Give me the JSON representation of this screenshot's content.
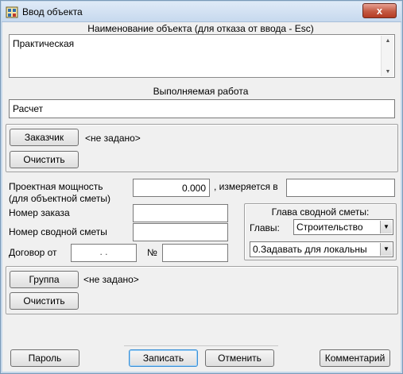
{
  "window": {
    "title": "Ввод объекта",
    "close_label": "x"
  },
  "object_name": {
    "header": "Наименование объекта (для отказа от ввода - Esc)",
    "value": "Практическая"
  },
  "work": {
    "header": "Выполняемая работа",
    "value": "Расчет"
  },
  "customer": {
    "button_label": "Заказчик",
    "value": "<не задано>",
    "clear_label": "Очистить"
  },
  "capacity": {
    "label_line1": "Проектная мощность",
    "label_line2": "(для объектной сметы)",
    "value": "0.000",
    "measured_in_label": ", измеряется в",
    "measured_in_value": ""
  },
  "order_number": {
    "label": "Номер заказа",
    "value": ""
  },
  "summary_number": {
    "label": "Номер сводной сметы",
    "value": ""
  },
  "contract": {
    "label": "Договор от",
    "date_value": " .  .",
    "number_label": "№",
    "number_value": ""
  },
  "summary_chapter": {
    "title": "Глава сводной сметы:",
    "chapters_label": "Главы:",
    "chapters_value": "Строительство",
    "mode_value": "0.Задавать для локальны"
  },
  "group": {
    "button_label": "Группа",
    "value": "<не задано>",
    "clear_label": "Очистить"
  },
  "footer": {
    "password_label": "Пароль",
    "save_label": "Записать",
    "cancel_label": "Отменить",
    "comment_label": "Комментарий"
  }
}
